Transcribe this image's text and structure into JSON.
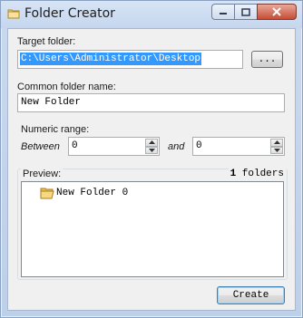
{
  "window": {
    "title": "Folder Creator",
    "icon": "folder-icon"
  },
  "target": {
    "label": "Target folder:",
    "value": "C:\\Users\\Administrator\\Desktop",
    "browse_label": "..."
  },
  "common_name": {
    "label": "Common folder name:",
    "value": "New Folder"
  },
  "range": {
    "label": "Numeric range:",
    "between_label": "Between",
    "and_label": "and",
    "from_value": "0",
    "to_value": "0"
  },
  "preview": {
    "label": "Preview:",
    "count": "1",
    "count_suffix": "folders",
    "items": [
      {
        "label": "New Folder 0",
        "icon": "folder-icon"
      }
    ]
  },
  "actions": {
    "create_label": "Create"
  }
}
